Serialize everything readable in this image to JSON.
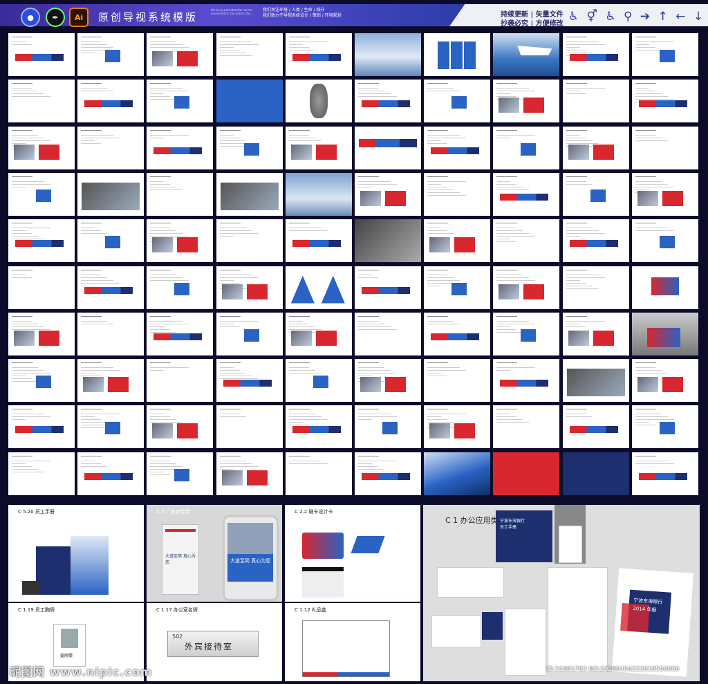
{
  "header": {
    "app_icons": [
      {
        "name": "cinema4d-icon",
        "label": "",
        "color": "#2b4fd8"
      },
      {
        "name": "coreldraw-icon",
        "label": "✒",
        "color": "#1a1a1a"
      },
      {
        "name": "illustrator-icon",
        "label": "Ai",
        "color": "#ff7b00"
      }
    ],
    "title": "原创导视系统模版",
    "sub_en": "We have paid attention to the environment, the public, life, ...",
    "sub_cn_1": "我们关注环境 / 人类 / 生命 / 线升",
    "sub_cn_2": "我们致力于导视系统设计 / 策划 / 环境规划",
    "tag_1": "持续更新 | 矢量文件",
    "tag_2": "抄袭必究 | 方便修改",
    "icons": "♿ ⚥ ♿ ⚲ ➔ ↑ ← ↓"
  },
  "bottom": {
    "c520": "C 5.20 员工手册",
    "c3": "C 3 广告宣传类",
    "c22": "C 2.2 磁卡设计卡",
    "c1": "C 1 办公应用类",
    "c119": "C 1.19 员工胸牌",
    "c117": "C 1.17 办公室名牌",
    "c112": "C 1.12 礼品盒",
    "room_no": "502",
    "room_name": "外宾接待室",
    "slogan_cn": "大道至简 真心为您",
    "slogan_en": "Your business is our business. cares for you",
    "bank_name": "宁波东海银行",
    "report_title": "2014 年报",
    "report_en": "NDHB 2014 Annual Report",
    "staff_manual": "员工手册",
    "badge_name": "姜雨霏"
  },
  "watermark": "昵图网 www.nipic.com",
  "image_id": "ID:31001783 NO:20200404222618550086",
  "colors": {
    "navy": "#1d2f6e",
    "red": "#d8272f",
    "blue": "#2a63c4"
  }
}
